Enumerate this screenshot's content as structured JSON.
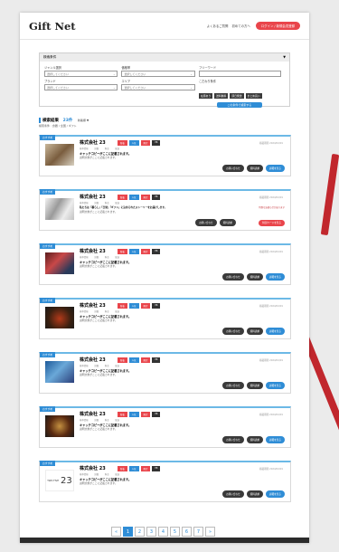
{
  "header": {
    "logo": "Gift Net",
    "links": [
      "よくあるご質問",
      "初めての方へ"
    ],
    "cta": "ログイン / 新規会員登録"
  },
  "search_panel": {
    "title": "検索条件",
    "fields": [
      {
        "label": "ジャンル選択",
        "value": "選択してください"
      },
      {
        "label": "価格帯",
        "value": "選択してください"
      },
      {
        "label": "ブランド",
        "value": "選択してください"
      },
      {
        "label": "エリア",
        "value": "選択してください"
      }
    ],
    "keyword_label": "フリーワード",
    "condition_label": "こだわり条件",
    "chips": [
      "在庫あり",
      "送料無料",
      "即日発送",
      "まとめ買い"
    ],
    "submit": "この条件で検索する"
  },
  "results": {
    "title": "検索結果",
    "count": "23件",
    "sort_label": "新着順",
    "meta": "検索条件 : 食器 / 全国 / ギフト"
  },
  "cards": [
    {
      "tag": "おすすめ",
      "company": "株式会社 23",
      "badges": [
        "新着",
        "人気",
        "限定",
        "PR"
      ],
      "minor": "基本情報 詳細 料金 配送",
      "catch": "キャッチコピーがここに記載されます。",
      "desc": "説明文章がここに記載されます。",
      "date": "掲載期間 2024/04/01",
      "actions": [
        "お問い合わせ",
        "資料請求",
        "詳細を見る"
      ]
    },
    {
      "tag": "おすすめ",
      "company": "株式会社 23",
      "badges": [
        "新着",
        "人気",
        "限定",
        "PR"
      ],
      "minor": "基本情報 詳細 料金 配送",
      "catch": "私たちは「暮らし」「日常」「ギフト」に込められたストーリーをお届けします。",
      "desc": "説明文章がここに記載されます。",
      "date": "掲載期間 2024/04/01",
      "special_note": "特別なお知らせがあります",
      "actions": [
        "お問い合わせ",
        "資料請求",
        "特別ページを見る"
      ]
    },
    {
      "tag": "おすすめ",
      "company": "株式会社 23",
      "badges": [
        "新着",
        "人気",
        "限定",
        "PR"
      ],
      "minor": "基本情報 詳細 料金 配送",
      "catch": "キャッチコピーがここに記載されます。",
      "desc": "説明文章がここに記載されます。",
      "date": "掲載期間 2024/04/01",
      "actions": [
        "お問い合わせ",
        "資料請求",
        "詳細を見る"
      ]
    },
    {
      "tag": "おすすめ",
      "company": "株式会社 23",
      "badges": [
        "新着",
        "人気",
        "限定",
        "PR"
      ],
      "minor": "基本情報 詳細 料金 配送",
      "catch": "キャッチコピーがここに記載されます。",
      "desc": "説明文章がここに記載されます。",
      "date": "掲載期間 2024/04/01",
      "actions": [
        "お問い合わせ",
        "資料請求",
        "詳細を見る"
      ]
    },
    {
      "tag": "おすすめ",
      "company": "株式会社 23",
      "badges": [
        "新着",
        "人気",
        "限定",
        "PR"
      ],
      "minor": "基本情報 詳細 料金 配送",
      "catch": "キャッチコピーがここに記載されます。",
      "desc": "説明文章がここに記載されます。",
      "date": "掲載期間 2024/04/01",
      "actions": [
        "お問い合わせ",
        "資料請求",
        "詳細を見る"
      ]
    },
    {
      "tag": "おすすめ",
      "company": "株式会社 23",
      "badges": [
        "新着",
        "人気",
        "限定",
        "PR"
      ],
      "minor": "基本情報 詳細 料金 配送",
      "catch": "キャッチコピーがここに記載されます。",
      "desc": "説明文章がここに記載されます。",
      "date": "掲載期間 2024/04/01",
      "actions": [
        "お問い合わせ",
        "資料請求",
        "詳細を見る"
      ]
    },
    {
      "tag": "おすすめ",
      "company": "株式会社 23",
      "badges": [
        "新着",
        "人気",
        "限定",
        "PR"
      ],
      "minor": "基本情報 詳細 料金 配送",
      "catch": "キャッチコピーがここに記載されます。",
      "desc": "説明文章がここに記載されます。",
      "date": "掲載期間 2024/04/01",
      "thumb_text": {
        "prefix": "TWO FIVE",
        "number": "23"
      },
      "actions": [
        "お問い合わせ",
        "資料請求",
        "詳細を見る"
      ]
    }
  ],
  "pagination": {
    "prev": "«",
    "pages": [
      "1",
      "2",
      "3",
      "4",
      "5",
      "6",
      "7"
    ],
    "current": "1",
    "next": "»"
  },
  "colors": {
    "accent": "#2f8dd6",
    "brand_red": "#e9454b",
    "dark": "#3a3a3a"
  }
}
